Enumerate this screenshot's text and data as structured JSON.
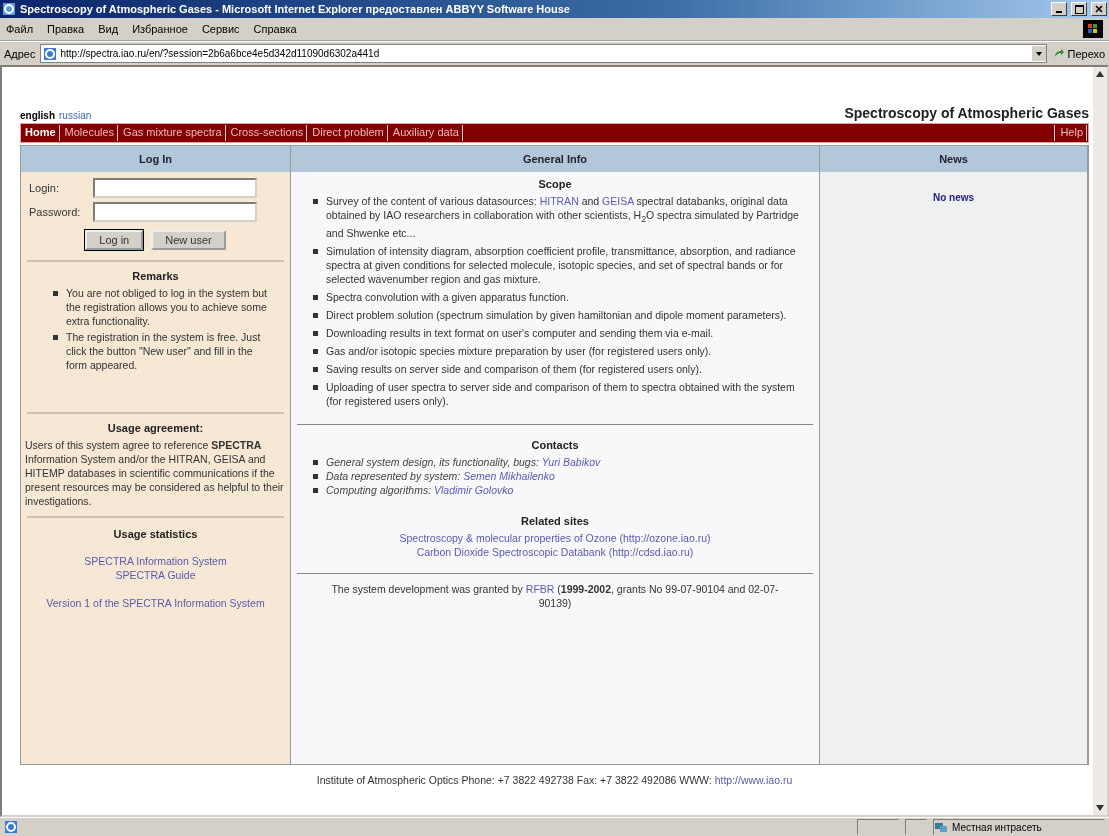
{
  "window": {
    "title": "Spectroscopy of Atmospheric Gases - Microsoft Internet Explorer предоставлен ABBYY Software House",
    "menu": [
      "Файл",
      "Правка",
      "Вид",
      "Избранное",
      "Сервис",
      "Справка"
    ]
  },
  "address_bar": {
    "label": "Адрес",
    "url": "http://spectra.iao.ru/en/?session=2b6a6bce4e5d342d11090d6302a441d",
    "go_button": "Перехо"
  },
  "page": {
    "languages": [
      {
        "label": "english",
        "selected": true
      },
      {
        "label": "russian",
        "selected": false
      }
    ],
    "site_title": "Spectroscopy of Atmospheric Gases",
    "nav": [
      {
        "label": "Home",
        "selected": true
      },
      {
        "label": "Molecules",
        "selected": false
      },
      {
        "label": "Gas mixture spectra",
        "selected": false
      },
      {
        "label": "Cross-sections",
        "selected": false
      },
      {
        "label": "Direct problem",
        "selected": false
      },
      {
        "label": "Auxiliary data",
        "selected": false
      }
    ],
    "nav_help": "Help",
    "login": {
      "header": "Log In",
      "fields": [
        {
          "label": "Login:"
        },
        {
          "label": "Password:"
        }
      ],
      "buttons": [
        {
          "label": "Log in",
          "kind": "default"
        },
        {
          "label": "New user",
          "kind": "normal"
        }
      ]
    },
    "remarks": {
      "title": "Remarks",
      "items": [
        "You are not obliged to log in the system but the registration allows you to achieve some extra functionality.",
        "The registration in the system is free. Just click the button \"New user\" and fill in the form appeared."
      ]
    },
    "agreement": {
      "title": "Usage agreement:",
      "text": "Users of this system agree to reference **SPECTRA** Information System and/or the HITRAN, GEISA and HITEMP databases in scientific communications if the present resources may be considered as helpful to their investigations."
    },
    "statistics": {
      "title": "Usage statistics",
      "groups": [
        [
          "SPECTRA Information System",
          "SPECTRA Guide"
        ],
        [
          "Version 1 of the SPECTRA Information System"
        ]
      ]
    },
    "general": {
      "header": "General Info",
      "scope": {
        "title": "Scope",
        "items": [
          [
            {
              "kind": "plain",
              "text": "Survey of the content of various datasources: "
            },
            {
              "kind": "link",
              "text": "HITRAN"
            },
            {
              "kind": "plain",
              "text": " and "
            },
            {
              "kind": "link",
              "text": "GEISA"
            },
            {
              "kind": "plain",
              "text": " spectral databanks, original data obtained by IAO researchers in collaboration with other scientists, H$_{2}$O spectra simulated by Partridge and Shwenke etc..."
            }
          ],
          [
            {
              "kind": "plain",
              "text": "Simulation of intensity diagram, absorption coefficient profile, transmittance, absorption, and radiance spectra at given conditions for selected molecule, isotopic species, and set of spectral bands or for selected wavenumber region and gas mixture."
            }
          ],
          [
            {
              "kind": "plain",
              "text": "Spectra convolution with a given apparatus function."
            }
          ],
          [
            {
              "kind": "plain",
              "text": "Direct problem solution (spectrum simulation by given hamiltonian and dipole moment parameters)."
            }
          ],
          [
            {
              "kind": "plain",
              "text": "Downloading results in text format on user's computer and sending them via e-mail."
            }
          ],
          [
            {
              "kind": "plain",
              "text": "Gas and/or isotopic species mixture preparation by user (for registered users only)."
            }
          ],
          [
            {
              "kind": "plain",
              "text": "Saving results on server side and comparison of them (for registered users only)."
            }
          ],
          [
            {
              "kind": "plain",
              "text": "Uploading of user spectra to server side and comparison of them to spectra obtained with the system (for registered users only)."
            }
          ]
        ]
      },
      "contacts": {
        "title": "Contacts",
        "items": [
          {
            "role": "General system design, its functionality, bugs:",
            "person": "Yuri Babikov"
          },
          {
            "role": "Data represented by system:",
            "person": "Semen Mikhailenko"
          },
          {
            "role": "Computing algorithms:",
            "person": "Vladimir Golovko"
          }
        ]
      },
      "related": {
        "title": "Related sites",
        "links": [
          "Spectroscopy & molecular properties of Ozone (http://ozone.iao.ru)",
          "Carbon Dioxide Spectroscopic Databank (http://cdsd.iao.ru)"
        ]
      },
      "grant": [
        {
          "kind": "plain",
          "text": "The system development was granted by "
        },
        {
          "kind": "link",
          "text": "RFBR"
        },
        {
          "kind": "plain",
          "text": " (**1999-2002**, grants No 99-07-90104 and 02-07-90139)"
        }
      ]
    },
    "news": {
      "header": "News",
      "text": "No news"
    },
    "footer": [
      {
        "kind": "plain",
        "text": "Institute of Atmospheric Optics  Phone: +7 3822 492738 Fax: +7 3822 492086  WWW: "
      },
      {
        "kind": "link",
        "text": "http://www.iao.ru"
      }
    ]
  },
  "status_bar": {
    "zone": "Местная интрасеть"
  }
}
